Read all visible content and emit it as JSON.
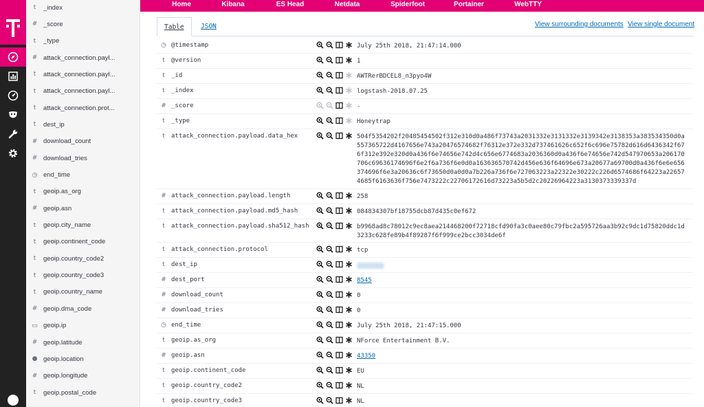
{
  "topnav": {
    "items": [
      "Home",
      "Kibana",
      "ES Head",
      "Netdata",
      "Spiderfoot",
      "Portainer",
      "WebTTY"
    ]
  },
  "rail": {
    "logo_icon": "telekom-t-icon",
    "icons": [
      "compass-icon",
      "bar-chart-icon",
      "dashboard-gauge-icon",
      "mask-icon",
      "wrench-icon",
      "gear-icon"
    ],
    "active_color": "#e20074"
  },
  "sidebar": {
    "fields": [
      {
        "type": "t",
        "name": "_index"
      },
      {
        "type": "#",
        "name": "_score"
      },
      {
        "type": "t",
        "name": "_type"
      },
      {
        "type": "#",
        "name": "attack_connection.payl..."
      },
      {
        "type": "t",
        "name": "attack_connection.payl..."
      },
      {
        "type": "t",
        "name": "attack_connection.payl..."
      },
      {
        "type": "t",
        "name": "attack_connection.prot..."
      },
      {
        "type": "t",
        "name": "dest_ip"
      },
      {
        "type": "#",
        "name": "download_count"
      },
      {
        "type": "#",
        "name": "download_tries"
      },
      {
        "type": "clock",
        "name": "end_time"
      },
      {
        "type": "t",
        "name": "geoip.as_org"
      },
      {
        "type": "#",
        "name": "geoip.asn"
      },
      {
        "type": "t",
        "name": "geoip.city_name"
      },
      {
        "type": "t",
        "name": "geoip.continent_code"
      },
      {
        "type": "t",
        "name": "geoip.country_code2"
      },
      {
        "type": "t",
        "name": "geoip.country_code3"
      },
      {
        "type": "t",
        "name": "geoip.country_name"
      },
      {
        "type": "#",
        "name": "geoip.dma_code"
      },
      {
        "type": "ip",
        "name": "geoip.ip"
      },
      {
        "type": "#",
        "name": "geoip.latitude"
      },
      {
        "type": "geo",
        "name": "geoip.location"
      },
      {
        "type": "#",
        "name": "geoip.longitude"
      },
      {
        "type": "t",
        "name": "geoip.postal_code"
      }
    ]
  },
  "doc": {
    "tabs": [
      "Table",
      "JSON"
    ],
    "links": [
      "View surrounding documents",
      "View single document"
    ],
    "rows": [
      {
        "type": "clock",
        "field": "@timestamp",
        "value": "July 25th 2018, 21:47:14.000",
        "style": "normal",
        "filterable": true
      },
      {
        "type": "t",
        "field": "@version",
        "value": "1",
        "style": "normal",
        "filterable": true
      },
      {
        "type": "t",
        "field": "_id",
        "value": "AWTRerBDCEL8_n3pyo4W",
        "style": "normal",
        "filterable": true
      },
      {
        "type": "t",
        "field": "_index",
        "value": "logstash-2018.07.25",
        "style": "normal",
        "filterable": true
      },
      {
        "type": "#",
        "field": "_score",
        "value": " -",
        "style": "normal",
        "filterable": false
      },
      {
        "type": "t",
        "field": "_type",
        "value": "Honeytrap",
        "style": "normal",
        "filterable": true
      },
      {
        "type": "t",
        "field": "attack_connection.payload.data_hex",
        "value": "504f5354202f20485454502f312e310d0a486f73743a2031332e3131332e3139342e3138353a383534350d0a557365722d4167656e743a20476574682f76312e372e332d737461626c652f6c696e75782d616d6436342f676f312e392e320d0a436f6e74656e742d4c656e6774683a2036360d0a436f6e74656e742d547970653a206170706c69636174696f6e2f6a736f6e0d0a163636570742d456e636f64696e673a20677a69700d0a436f6e6e656374696f6e3a20636c6f73650d0a0d0a7b226a736f6e727063223a22322e30222c226d6574686f64223a226574685f6163636f756e7473222c22706172616d73223a5b5d2c20226964223a3130373339337d",
        "style": "normal",
        "filterable": true
      },
      {
        "type": "#",
        "field": "attack_connection.payload.length",
        "value": "258",
        "style": "normal",
        "filterable": true
      },
      {
        "type": "t",
        "field": "attack_connection.payload.md5_hash",
        "value": "084834307bf18755dcb87d435c0ef672",
        "style": "normal",
        "filterable": true
      },
      {
        "type": "t",
        "field": "attack_connection.payload.sha512_hash",
        "value": "b9968ad8c78012c9ec8aea214468200f72718cfd90fa3c0aee80c79fbc2a595726aa3b92c9dc1d75820ddc1d3233c628fe89b4f89287f6f999ce2bcc3034de6f",
        "style": "normal",
        "filterable": true
      },
      {
        "type": "t",
        "field": "attack_connection.protocol",
        "value": "tcp",
        "style": "normal",
        "filterable": true
      },
      {
        "type": "t",
        "field": "dest_ip",
        "value": "",
        "style": "blur",
        "filterable": true
      },
      {
        "type": "#",
        "field": "dest_port",
        "value": "8545",
        "style": "link",
        "filterable": true
      },
      {
        "type": "#",
        "field": "download_count",
        "value": "0",
        "style": "normal",
        "filterable": true
      },
      {
        "type": "#",
        "field": "download_tries",
        "value": "0",
        "style": "normal",
        "filterable": true
      },
      {
        "type": "clock",
        "field": "end_time",
        "value": "July 25th 2018, 21:47:15.000",
        "style": "normal",
        "filterable": true
      },
      {
        "type": "t",
        "field": "geoip.as_org",
        "value": "NForce Entertainment B.V.",
        "style": "normal",
        "filterable": true
      },
      {
        "type": "#",
        "field": "geoip.asn",
        "value": "43350",
        "style": "link",
        "filterable": true
      },
      {
        "type": "t",
        "field": "geoip.continent_code",
        "value": "EU",
        "style": "normal",
        "filterable": true
      },
      {
        "type": "t",
        "field": "geoip.country_code2",
        "value": "NL",
        "style": "normal",
        "filterable": true
      },
      {
        "type": "t",
        "field": "geoip.country_code3",
        "value": "NL",
        "style": "normal",
        "filterable": true
      }
    ]
  }
}
